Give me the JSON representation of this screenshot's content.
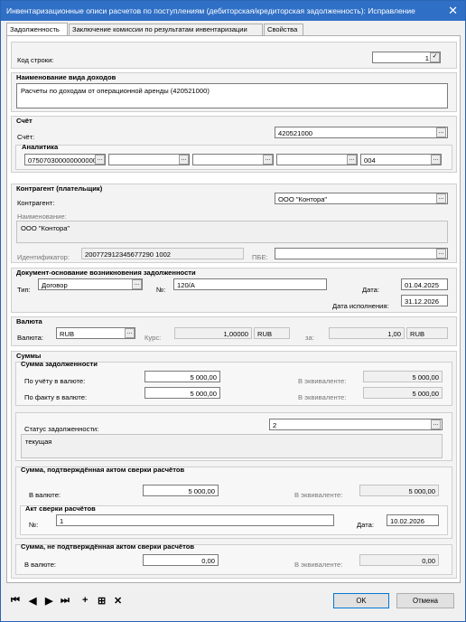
{
  "window": {
    "title": "Инвентаризационные описи расчетов по поступлениям (дебиторская/кредиторская задолженность): Исправление",
    "close": "✕"
  },
  "tabs": [
    "Задолженность",
    "Заключение комиссии по результатам инвентаризации",
    "Свойства"
  ],
  "code_row": {
    "label": "Код строки:",
    "value": "1",
    "check": "✓"
  },
  "income_type": {
    "title": "Наименование вида доходов",
    "value": "Расчеты по доходам от операционной аренды (420521000)"
  },
  "account": {
    "title": "Счёт",
    "label": "Счёт:",
    "value": "420521000",
    "analytics_title": "Аналитика",
    "analytics": [
      "075070300000000000",
      "",
      "",
      "",
      "004"
    ]
  },
  "counterparty": {
    "title": "Контрагент (плательщик)",
    "label": "Контрагент:",
    "value": "ООО \"Контора\"",
    "name_label": "Наименование:",
    "name_value": "ООО \"Контора\"",
    "id_label": "Идентификатор:",
    "id_value": "200772912345677290 1002",
    "pbe_label": "ПБЕ:",
    "pbe_value": ""
  },
  "document": {
    "title": "Документ-основание возникновения задолженности",
    "type_label": "Тип:",
    "type_value": "Договор",
    "num_label": "№:",
    "num_value": "120/А",
    "date_label": "Дата:",
    "date_value": "01.04.2025",
    "exec_label": "Дата исполнения:",
    "exec_value": "31.12.2026"
  },
  "currency": {
    "title": "Валюта",
    "label": "Валюта:",
    "value": "RUB",
    "rate_label": "Курс:",
    "rate_value": "1,00000",
    "rate_cur": "RUB",
    "for_label": "за:",
    "for_value": "1,00",
    "for_cur": "RUB"
  },
  "sums": {
    "title": "Суммы",
    "debt_title": "Сумма задолженности",
    "account_label": "По учёту в валюте:",
    "account_value": "5 000,00",
    "equiv_label": "В эквиваленте:",
    "account_equiv": "5 000,00",
    "fact_label": "По факту в валюте:",
    "fact_value": "5 000,00",
    "fact_equiv": "5 000,00",
    "status_label": "Статус задолженности:",
    "status_value": "2",
    "status_text": "текущая"
  },
  "confirmed": {
    "title": "Сумма, подтверждённая актом сверки расчётов",
    "cur_label": "В валюте:",
    "cur_value": "5 000,00",
    "equiv_label": "В эквиваленте:",
    "equiv_value": "5 000,00",
    "act_title": "Акт сверки расчётов",
    "num_label": "№:",
    "num_value": "1",
    "date_label": "Дата:",
    "date_value": "10.02.2026"
  },
  "unconfirmed": {
    "title": "Сумма, не подтверждённая актом сверки расчётов",
    "cur_label": "В валюте:",
    "cur_value": "0,00",
    "equiv_label": "В эквиваленте:",
    "equiv_value": "0,00"
  },
  "footer": {
    "first": "⏮",
    "prev": "◀",
    "next": "▶",
    "last": "⏭",
    "add": "+",
    "add_copy": "⊞",
    "delete": "✕",
    "ok": "OK",
    "cancel": "Отмена"
  },
  "ellipsis": "..."
}
